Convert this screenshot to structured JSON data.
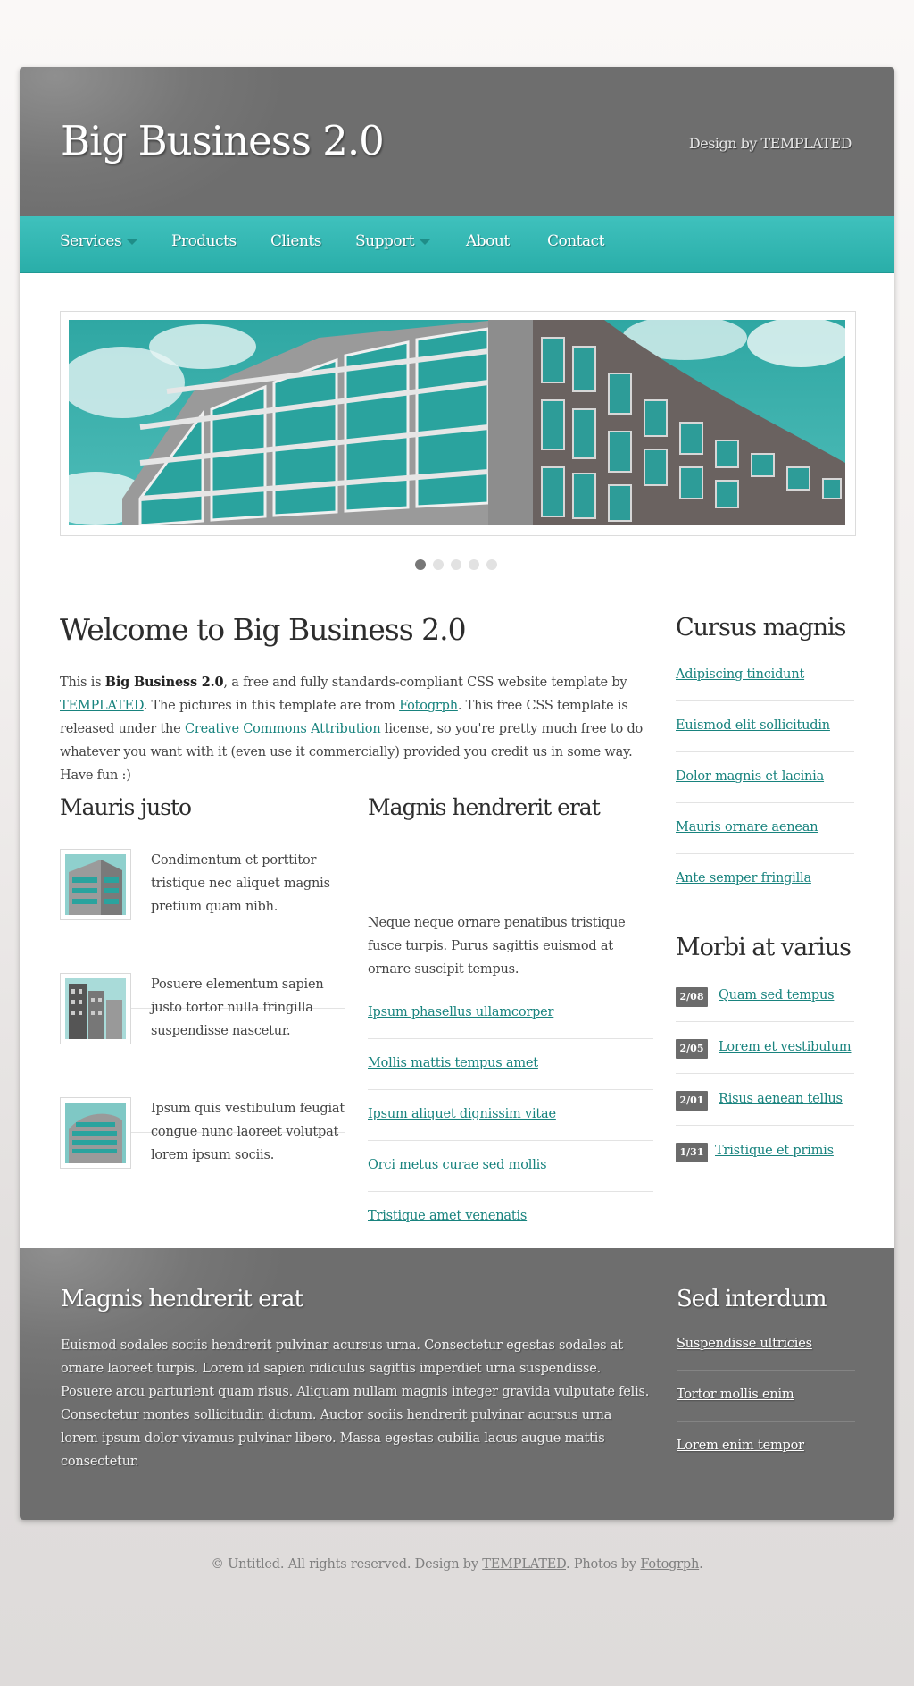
{
  "header": {
    "site_title": "Big Business 2.0",
    "design_by": "Design by TEMPLATED"
  },
  "nav": {
    "items": [
      {
        "label": "Services",
        "has_dropdown": true
      },
      {
        "label": "Products",
        "has_dropdown": false
      },
      {
        "label": "Clients",
        "has_dropdown": false
      },
      {
        "label": "Support",
        "has_dropdown": true
      },
      {
        "label": "About",
        "has_dropdown": false
      },
      {
        "label": "Contact",
        "has_dropdown": false
      }
    ]
  },
  "slider": {
    "slide_count": 5,
    "active_index": 0
  },
  "welcome": {
    "title": "Welcome to Big Business 2.0",
    "p1": "This is ",
    "bold": "Big Business 2.0",
    "p2": ", a free and fully standards-compliant CSS website template by ",
    "link1": "TEMPLATED",
    "p3": ". The pictures in this template are from ",
    "link2": "Fotogrph",
    "p4": ". This free CSS template is released under the ",
    "link3": "Creative Commons Attribution",
    "p5": " license, so you're pretty much free to do whatever you want with it (even use it commercially) provided you credit us in some way. Have fun :)"
  },
  "left_column": {
    "title": "Mauris justo",
    "items": [
      {
        "text": "Condimentum et porttitor tristique nec aliquet magnis pretium quam nibh."
      },
      {
        "text": "Posuere elementum sapien justo tortor nulla fringilla suspendisse nascetur."
      },
      {
        "text": "Ipsum quis vestibulum feugiat congue nunc laoreet volutpat lorem ipsum sociis."
      }
    ]
  },
  "middle_column": {
    "title": "Magnis hendrerit erat",
    "text": "Neque neque ornare penatibus tristique fusce turpis. Purus sagittis euismod at ornare suscipit tempus.",
    "links": [
      "Ipsum phasellus ullamcorper",
      "Mollis mattis tempus amet",
      "Ipsum aliquet dignissim vitae",
      "Orci metus curae sed mollis",
      "Tristique amet venenatis"
    ]
  },
  "sidebar": {
    "cursus": {
      "title": "Cursus magnis",
      "links": [
        "Adipiscing tincidunt",
        "Euismod elit sollicitudin",
        "Dolor magnis et lacinia",
        "Mauris ornare aenean",
        "Ante semper fringilla"
      ]
    },
    "morbi": {
      "title": "Morbi at varius",
      "items": [
        {
          "date": "2/08",
          "link": "Quam sed tempus"
        },
        {
          "date": "2/05",
          "link": "Lorem et vestibulum"
        },
        {
          "date": "2/01",
          "link": "Risus aenean tellus"
        },
        {
          "date": "1/31",
          "link": "Tristique et primis"
        }
      ]
    }
  },
  "footer": {
    "left_title": "Magnis hendrerit erat",
    "left_text": "Euismod sodales sociis hendrerit pulvinar acursus urna. Consectetur egestas sodales at ornare laoreet turpis. Lorem id sapien ridiculus sagittis imperdiet urna suspendisse. Posuere arcu parturient quam risus. Aliquam nullam magnis integer gravida vulputate felis. Consectetur montes sollicitudin dictum. Auctor sociis hendrerit pulvinar acursus urna lorem ipsum dolor vivamus pulvinar libero. Massa egestas cubilia lacus augue mattis consectetur.",
    "right_title": "Sed interdum",
    "links": [
      "Suspendisse ultricies",
      "Tortor mollis enim",
      "Lorem enim tempor"
    ]
  },
  "copyright": {
    "prefix": "© Untitled. All rights reserved. Design by ",
    "link1": "TEMPLATED",
    "middle": ". Photos by ",
    "link2": "Fotogrph",
    "suffix": "."
  },
  "colors": {
    "accent_teal": "#2fb4af",
    "link_teal": "#18837e",
    "header_gray": "#707070"
  }
}
